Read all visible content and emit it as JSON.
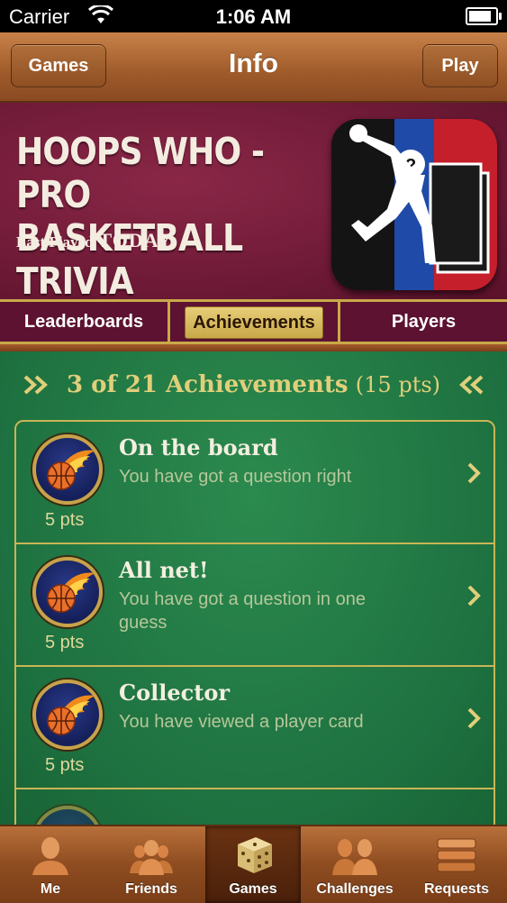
{
  "status_bar": {
    "carrier": "Carrier",
    "time": "1:06 AM"
  },
  "nav": {
    "back_label": "Games",
    "title": "Info",
    "play_label": "Play"
  },
  "game": {
    "title_line1": "HOOPS WHO - PRO",
    "title_line2": "BASKETBALL TRIVIA",
    "last_played_label": "Last Played",
    "last_played_value": "TODAY"
  },
  "segments": [
    {
      "label": "Leaderboards",
      "selected": false
    },
    {
      "label": "Achievements",
      "selected": true
    },
    {
      "label": "Players",
      "selected": false
    }
  ],
  "achievements_header": {
    "title": "3 of 21 Achievements",
    "points": "(15 pts)"
  },
  "achievements": [
    {
      "title": "On the board",
      "description": "You have got a question right",
      "points": "5 pts"
    },
    {
      "title": "All net!",
      "description": "You have got a question in one guess",
      "points": "5 pts"
    },
    {
      "title": "Collector",
      "description": "You have viewed a player card",
      "points": "5 pts"
    }
  ],
  "tabs": [
    {
      "label": "Me",
      "icon": "person-icon",
      "active": false
    },
    {
      "label": "Friends",
      "icon": "friends-icon",
      "active": false
    },
    {
      "label": "Games",
      "icon": "dice-icon",
      "active": true
    },
    {
      "label": "Challenges",
      "icon": "challenges-icon",
      "active": false
    },
    {
      "label": "Requests",
      "icon": "requests-icon",
      "active": false
    }
  ],
  "colors": {
    "felt": "#1f7a43",
    "banner": "#6a1834",
    "gold": "#c9a94a",
    "wood": "#9e5a2a"
  }
}
